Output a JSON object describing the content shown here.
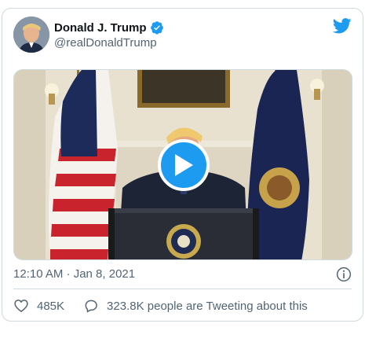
{
  "author": {
    "display_name": "Donald J. Trump",
    "handle": "@realDonaldTrump"
  },
  "media": {
    "type": "video"
  },
  "meta": {
    "timestamp": "12:10 AM · Jan 8, 2021"
  },
  "actions": {
    "likes": "485K",
    "conversation": "323.8K people are Tweeting about this"
  },
  "colors": {
    "accent": "#1d9bf0",
    "text_secondary": "#536471",
    "border": "#cfd9de"
  },
  "icons": [
    "avatar",
    "verified-badge-icon",
    "twitter-bird-icon",
    "play-icon",
    "info-icon",
    "heart-icon",
    "reply-icon"
  ]
}
